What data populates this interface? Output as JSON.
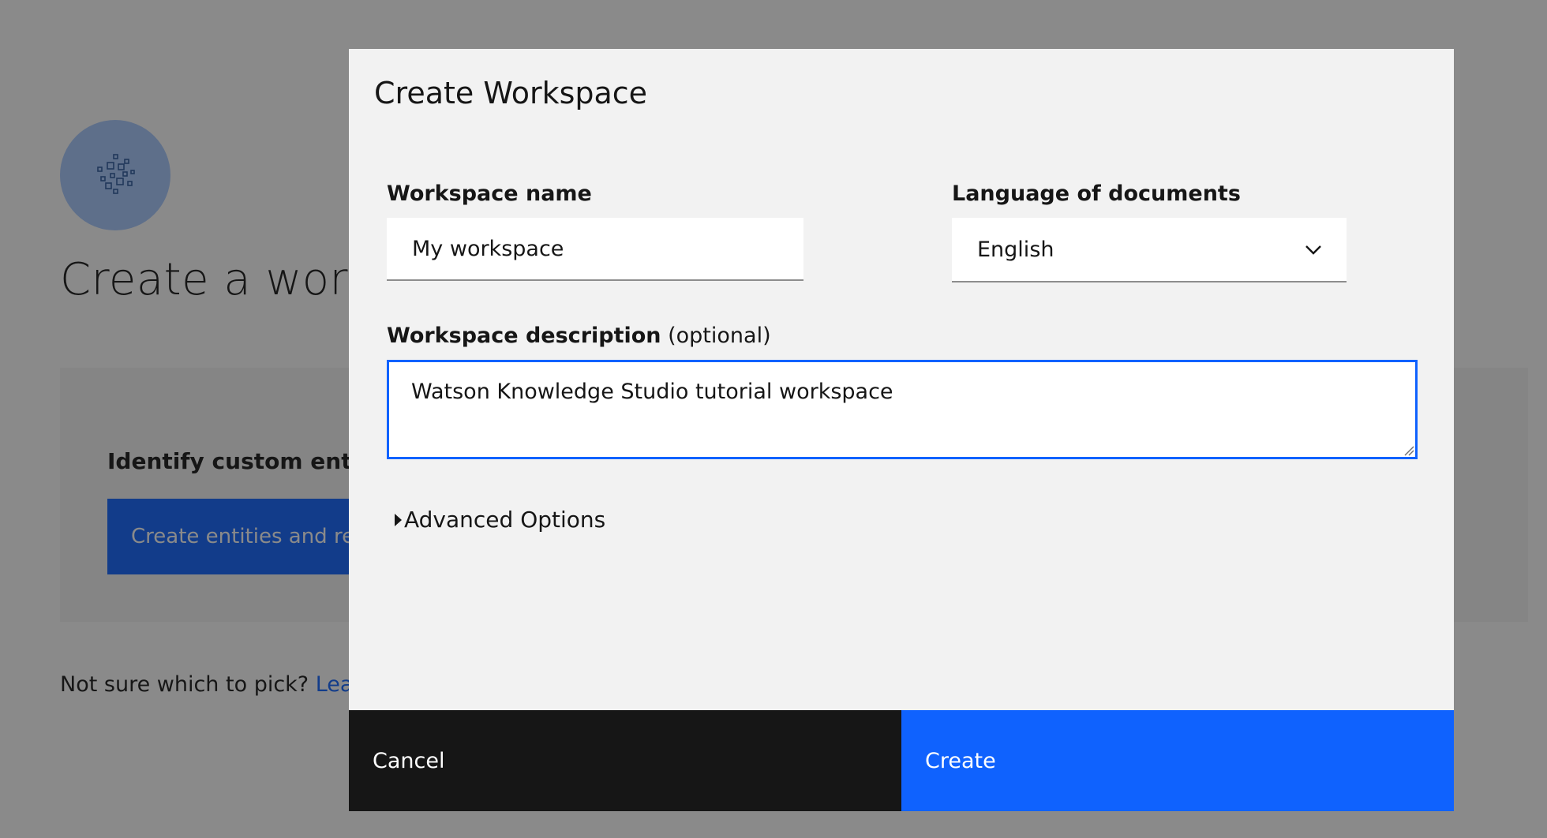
{
  "background": {
    "icon": "workspace-network-icon",
    "title": "Create a works",
    "option": {
      "heading": "Identify custom entite",
      "button_label": "Create entities and re"
    },
    "help": {
      "text": "Not sure which to pick? ",
      "link": "Learn"
    }
  },
  "modal": {
    "title": "Create Workspace",
    "workspace_name": {
      "label": "Workspace name",
      "value": "My workspace"
    },
    "language": {
      "label": "Language of documents",
      "value": "English",
      "icon": "chevron-down-icon"
    },
    "description": {
      "label": "Workspace description",
      "optional": " (optional)",
      "value": "Watson Knowledge Studio tutorial workspace"
    },
    "advanced_label": "Advanced Options",
    "cancel_label": "Cancel",
    "create_label": "Create"
  },
  "colors": {
    "primary": "#0f62fe",
    "dark": "#161616",
    "modal_bg": "#f2f2f2"
  }
}
